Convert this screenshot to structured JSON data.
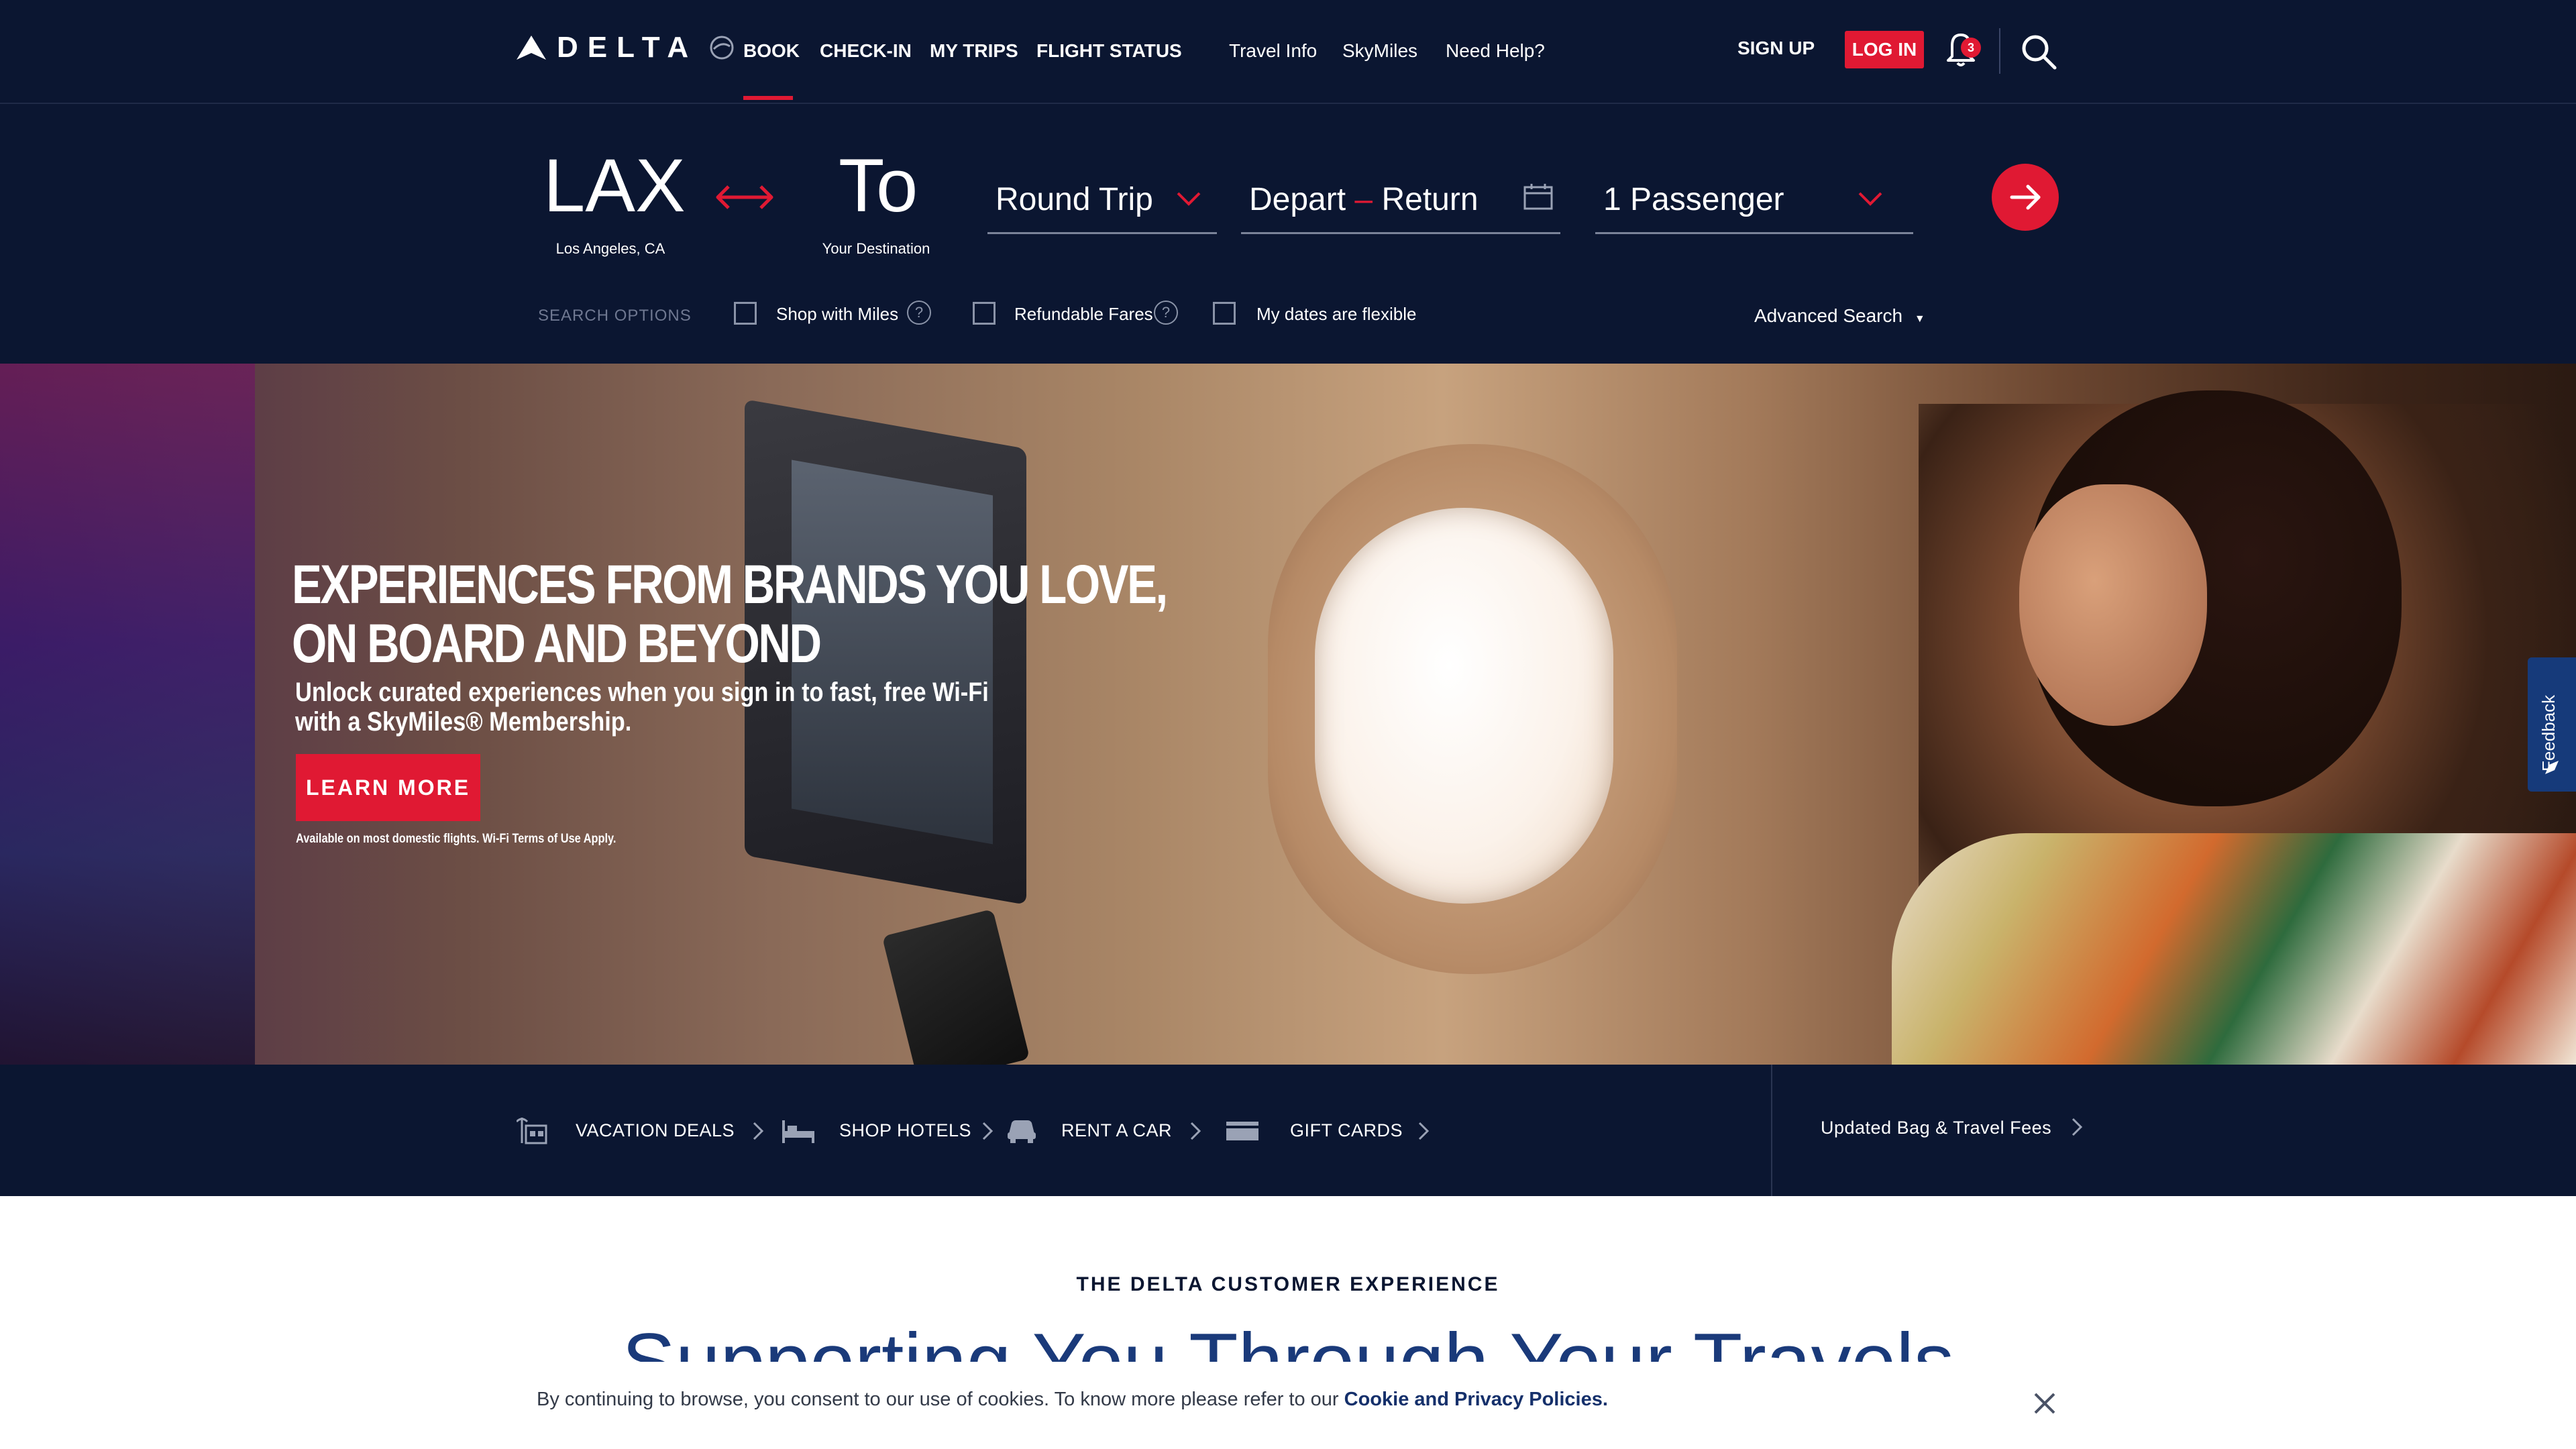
{
  "header": {
    "logo_text": "DELTA",
    "nav_primary": [
      "BOOK",
      "CHECK-IN",
      "MY TRIPS",
      "FLIGHT STATUS"
    ],
    "nav_secondary": [
      "Travel Info",
      "SkyMiles",
      "Need Help?"
    ],
    "signup_label": "SIGN UP",
    "login_label": "LOG IN",
    "notification_count": "3",
    "active_nav": "BOOK"
  },
  "booking": {
    "from_code": "LAX",
    "from_city": "Los Angeles, CA",
    "to_code": "To",
    "to_city": "Your Destination",
    "trip_type": "Round Trip",
    "depart_label": "Depart",
    "return_label": "Return",
    "passengers": "1 Passenger",
    "search_options_label": "SEARCH OPTIONS",
    "options": [
      "Shop with Miles",
      "Refundable Fares",
      "My dates are flexible"
    ],
    "advanced_search": "Advanced Search"
  },
  "hero": {
    "title_line1": "EXPERIENCES FROM BRANDS YOU LOVE,",
    "title_line2": "ON BOARD AND BEYOND",
    "subtitle_line1": "Unlock curated experiences when you sign in to fast, free Wi-Fi",
    "subtitle_line2": "with a SkyMiles® Membership.",
    "cta_label": "LEARN MORE",
    "disclaimer": "Available on most domestic flights. Wi-Fi Terms of Use Apply.",
    "feedback_label": "Feedback"
  },
  "quick_links": {
    "items": [
      "VACATION DEALS",
      "SHOP HOTELS",
      "RENT A CAR",
      "GIFT CARDS"
    ],
    "bag_fees": "Updated Bag & Travel Fees"
  },
  "section": {
    "eyebrow": "THE DELTA CUSTOMER EXPERIENCE",
    "heading": "Supporting You Through Your Travels"
  },
  "cookie": {
    "text": "By continuing to browse, you consent to our use of cookies. To know more please refer to our ",
    "link": "Cookie and Privacy Policies."
  },
  "colors": {
    "navy": "#0b1631",
    "red": "#e01933",
    "heading_blue": "#1a3a7a"
  }
}
